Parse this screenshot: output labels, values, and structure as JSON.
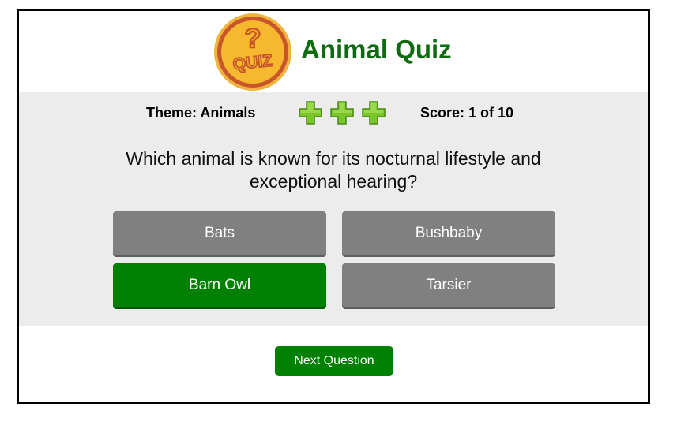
{
  "header": {
    "logo_icon": "quiz-coin-icon",
    "logo_text": "QUIZ",
    "title": "Animal Quiz"
  },
  "status": {
    "theme_label": "Theme: Animals",
    "lives": 3,
    "life_icon": "green-plus-icon",
    "score_label": "Score: 1 of 10"
  },
  "question": {
    "text": "Which animal is known for its nocturnal lifestyle and exceptional hearing?"
  },
  "answers": [
    {
      "label": "Bats",
      "state": "neutral"
    },
    {
      "label": "Bushbaby",
      "state": "neutral"
    },
    {
      "label": "Barn Owl",
      "state": "correct"
    },
    {
      "label": "Tarsier",
      "state": "neutral"
    }
  ],
  "footer": {
    "next_label": "Next Question"
  },
  "colors": {
    "title": "#0f6b0f",
    "correct": "#008000",
    "neutral": "#808080",
    "panel": "#ececec",
    "logo_gold": "#f5b82e",
    "logo_rim": "#c8562a"
  }
}
